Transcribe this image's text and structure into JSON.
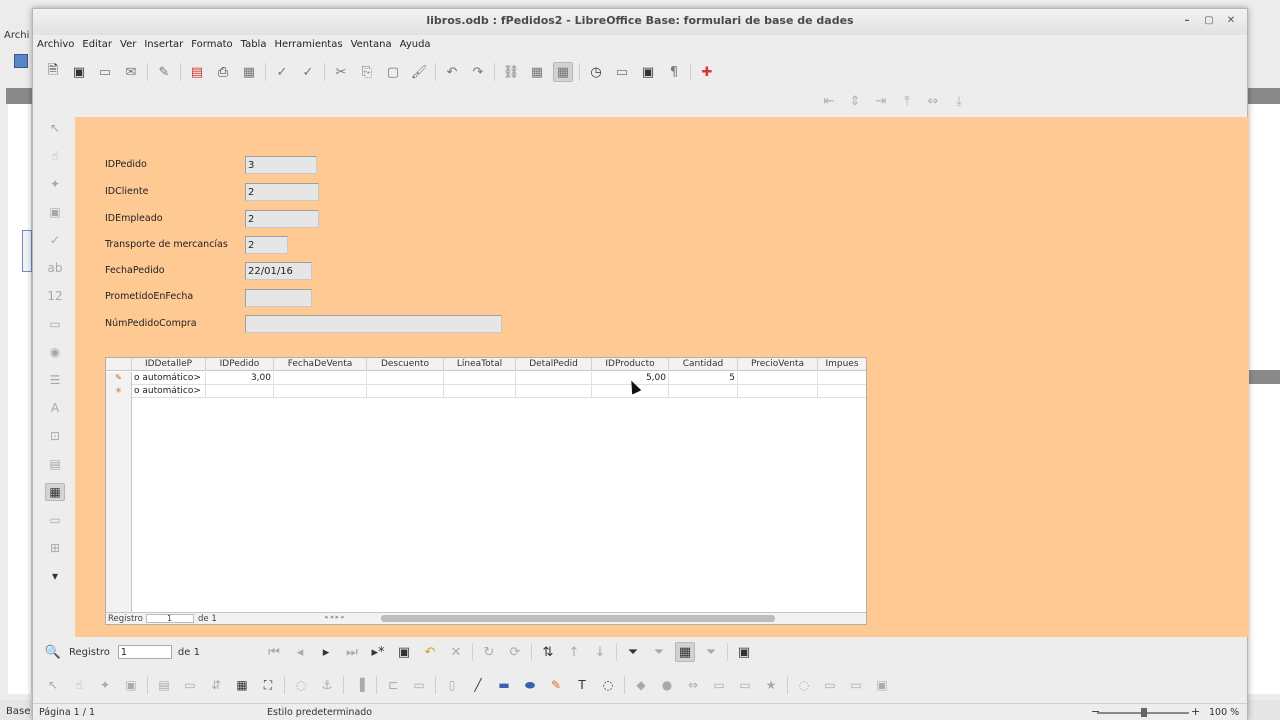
{
  "background_app": {
    "menu_fragment": "Archi",
    "status_fragment": "Base"
  },
  "window": {
    "title": "libros.odb : fPedidos2 - LibreOffice Base: formulari de base de dades"
  },
  "menu": [
    "Archivo",
    "Editar",
    "Ver",
    "Insertar",
    "Formato",
    "Tabla",
    "Herramientas",
    "Ventana",
    "Ayuda"
  ],
  "form": {
    "background_color": "#ffc994",
    "fields": [
      {
        "label": "IDPedido",
        "value": "3"
      },
      {
        "label": "IDCliente",
        "value": "2"
      },
      {
        "label": "IDEmpleado",
        "value": "2"
      },
      {
        "label": "Transporte de mercancías",
        "value": "2"
      },
      {
        "label": "FechaPedido",
        "value": "22/01/16"
      },
      {
        "label": "PrometidoEnFecha",
        "value": ""
      },
      {
        "label": "NúmPedidoCompra",
        "value": ""
      }
    ]
  },
  "grid": {
    "columns": [
      "IDDetalleP",
      "IDPedido",
      "FechaDeVenta",
      "Descuento",
      "LíneaTotal",
      "DetalPedid",
      "IDProducto",
      "Cantidad",
      "PrecioVenta",
      "Impues"
    ],
    "rows": [
      {
        "marker": "✎",
        "cells": [
          "o automático>",
          "3,00",
          "",
          "",
          "",
          "",
          "5,00",
          "5",
          "",
          ""
        ]
      },
      {
        "marker": "✳",
        "cells": [
          "o automático>",
          "",
          "",
          "",
          "",
          "",
          "",
          "",
          "",
          ""
        ]
      }
    ],
    "nav": {
      "label": "Registro",
      "value": "1",
      "of": "de 1"
    }
  },
  "record_nav": {
    "label": "Registro",
    "value": "1",
    "of": "de 1"
  },
  "status": {
    "page": "Página 1 / 1",
    "style": "Estilo predeterminado",
    "zoom": "100 %"
  }
}
